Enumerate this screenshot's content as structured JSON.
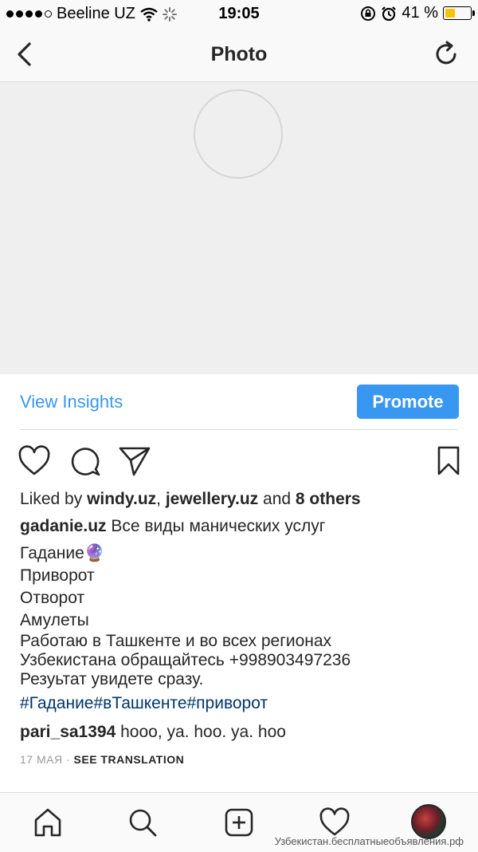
{
  "status_bar": {
    "carrier": "Beeline UZ",
    "time": "19:05",
    "battery": "41 %",
    "battery_level": 0.41,
    "icons": [
      "signal-dots",
      "wifi-icon",
      "loading-icon",
      "orientation-lock-icon",
      "alarm-icon",
      "battery-icon"
    ]
  },
  "nav": {
    "title": "Photo",
    "back_icon": "chevron-left-icon",
    "refresh_icon": "refresh-icon"
  },
  "insights": {
    "view_label": "View Insights",
    "promote_label": "Promote"
  },
  "actions": {
    "like_icon": "heart-icon",
    "comment_icon": "comment-icon",
    "share_icon": "send-icon",
    "save_icon": "bookmark-icon"
  },
  "likes": {
    "prefix": "Liked by ",
    "user1": "windy.uz",
    "sep": ", ",
    "user2": "jewellery.uz",
    "and": " and ",
    "others": "8 others"
  },
  "caption": {
    "username": "gadanie.uz",
    "first": " Все виды манических услуг",
    "lines": [
      "Гадание🔮",
      "Приворот",
      "Отворот",
      "Амулеты",
      "Работаю в Ташкенте и во всех регионах",
      "Узбекистана обращайтесь +998903497236",
      "Резуьтат увидете сразу."
    ],
    "hashtags": "#Гадание#вТашкенте#приворот"
  },
  "comment": {
    "username": "pari_sa1394",
    "text": " hooo, ya. hoo. ya. hoo"
  },
  "meta": {
    "date": "17 МАЯ",
    "separator": " · ",
    "see_translation": "SEE TRANSLATION"
  },
  "tab_bar": {
    "icons": [
      "home-icon",
      "search-icon",
      "add-icon",
      "activity-heart-icon",
      "profile-avatar"
    ]
  },
  "watermark": "Узбекистан.бесплатныеобъявления.рф",
  "colors": {
    "accent": "#3897f0",
    "hashtag": "#003569",
    "text": "#262626",
    "muted": "#999999",
    "photo_placeholder": "#efefef"
  }
}
